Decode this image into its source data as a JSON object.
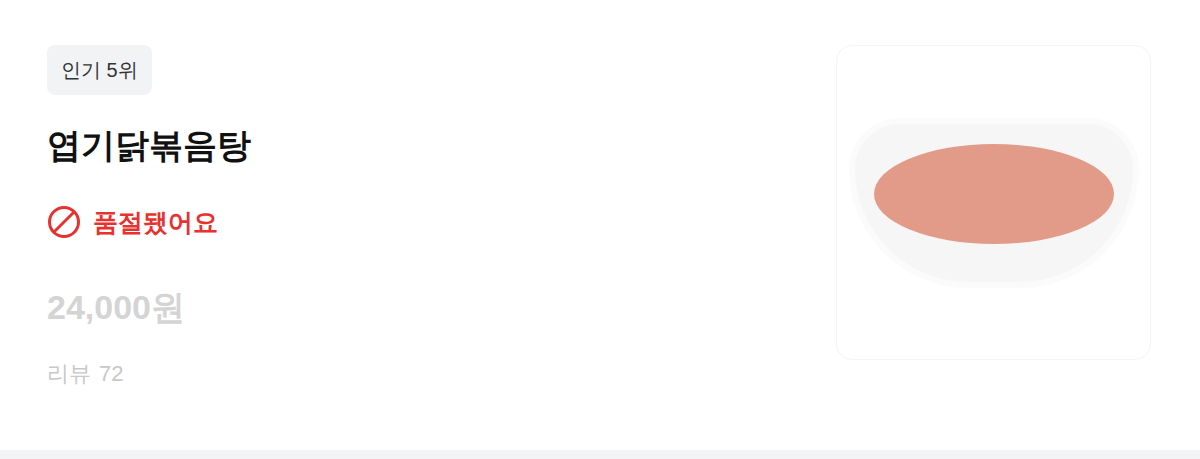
{
  "menu_item": {
    "badge": "인기 5위",
    "name": "엽기닭볶음탕",
    "status": {
      "text": "품절됐어요",
      "sold_out": true
    },
    "price": "24,000원",
    "reviews": {
      "label": "리뷰",
      "count": "72"
    }
  }
}
